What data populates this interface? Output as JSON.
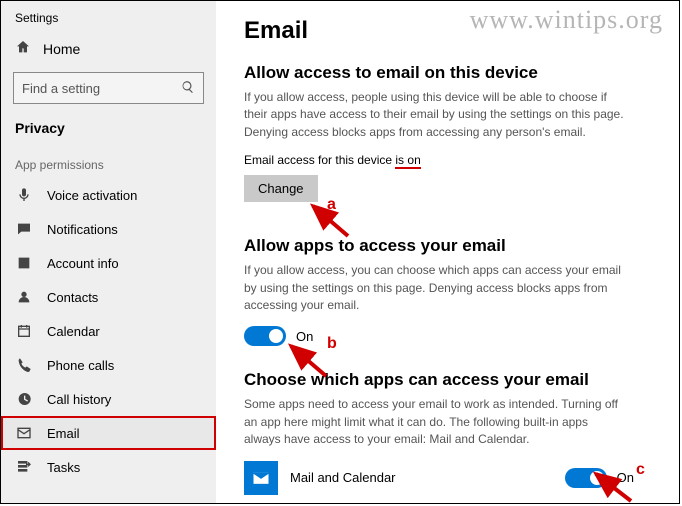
{
  "watermark": "www.wintips.org",
  "appTitle": "Settings",
  "home": "Home",
  "search": {
    "placeholder": "Find a setting"
  },
  "currentSection": "Privacy",
  "sectionHeader": "App permissions",
  "nav": {
    "voice": "Voice activation",
    "notifications": "Notifications",
    "account": "Account info",
    "contacts": "Contacts",
    "calendar": "Calendar",
    "phone": "Phone calls",
    "calls": "Call history",
    "email": "Email",
    "tasks": "Tasks"
  },
  "page": {
    "title": "Email",
    "s1": {
      "head": "Allow access to email on this device",
      "desc": "If you allow access, people using this device will be able to choose if their apps have access to their email by using the settings on this page. Denying access blocks apps from accessing any person's email.",
      "status_prefix": "Email access for this device ",
      "status_value": "is on",
      "change": "Change"
    },
    "s2": {
      "head": "Allow apps to access your email",
      "desc": "If you allow access, you can choose which apps can access your email by using the settings on this page. Denying access blocks apps from accessing your email.",
      "state": "On"
    },
    "s3": {
      "head": "Choose which apps can access your email",
      "desc": "Some apps need to access your email to work as intended. Turning off an app here might limit what it can do. The following built-in apps always have access to your email: Mail and Calendar.",
      "app": "Mail and Calendar",
      "state": "On"
    }
  },
  "anno": {
    "a": "a",
    "b": "b",
    "c": "c"
  }
}
